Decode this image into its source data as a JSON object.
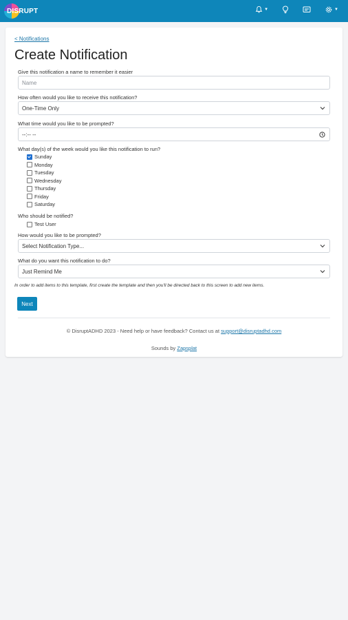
{
  "header": {
    "logo_text": "DISRUPT",
    "brand_color": "#0e86ba"
  },
  "breadcrumb": {
    "back_label": "< Notifications"
  },
  "page": {
    "title": "Create Notification"
  },
  "form": {
    "name": {
      "label": "Give this notification a name to remember it easier",
      "placeholder": "Name",
      "value": ""
    },
    "frequency": {
      "label": "How often would you like to receive this notification?",
      "selected": "One-Time Only"
    },
    "time": {
      "label": "What time would you like to be prompted?",
      "value": "--:-- --"
    },
    "days": {
      "label": "What day(s) of the week would you like this notification to run?",
      "options": [
        {
          "label": "Sunday",
          "checked": true
        },
        {
          "label": "Monday",
          "checked": false
        },
        {
          "label": "Tuesday",
          "checked": false
        },
        {
          "label": "Wednesday",
          "checked": false
        },
        {
          "label": "Thursday",
          "checked": false
        },
        {
          "label": "Friday",
          "checked": false
        },
        {
          "label": "Saturday",
          "checked": false
        }
      ]
    },
    "notify": {
      "label": "Who should be notified?",
      "options": [
        {
          "label": "Test User",
          "checked": false
        }
      ]
    },
    "type": {
      "label": "How would you like to be prompted?",
      "selected": "Select Notification Type..."
    },
    "action": {
      "label": "What do you want this notification to do?",
      "selected": "Just Remind Me"
    },
    "note": "In order to add items to this template, first create the template and then you'll be directed back to this screen to add new items.",
    "next_label": "Next"
  },
  "footer": {
    "copyright": "© DisruptADHD 2023 - Need help or have feedback? Contact us at",
    "email": "support@disruptadhd.com",
    "sounds_prefix": "Sounds by",
    "sounds_link": "Zapsplat"
  },
  "icons": [
    "bell-icon",
    "lightbulb-icon",
    "monitor-icon",
    "gear-icon",
    "clock-icon",
    "chevron-down-icon"
  ]
}
